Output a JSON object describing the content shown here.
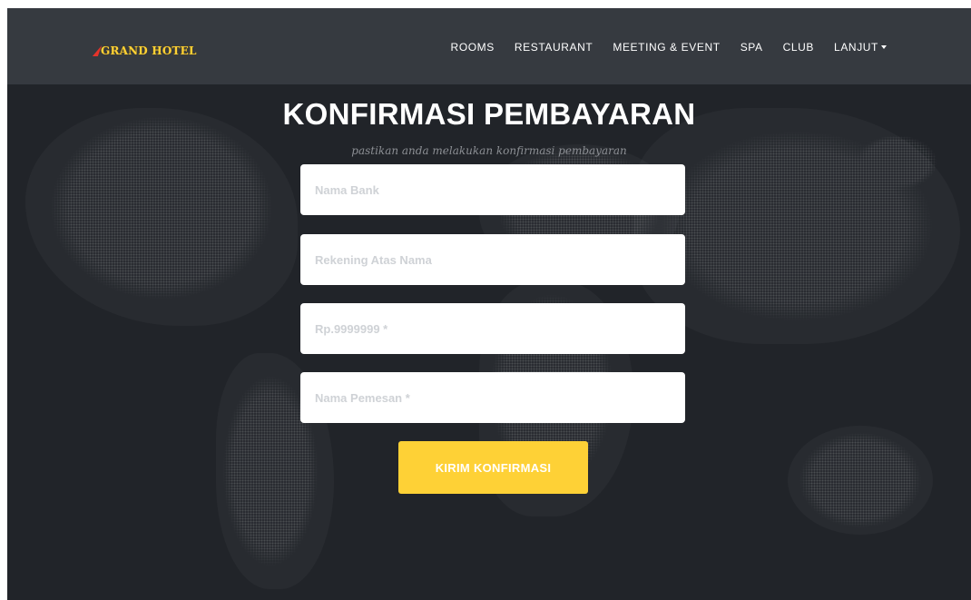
{
  "navbar": {
    "brand": "GRAND HOTEL",
    "items": [
      {
        "label": "ROOMS"
      },
      {
        "label": "RESTAURANT"
      },
      {
        "label": "MEETING & EVENT"
      },
      {
        "label": "SPA"
      },
      {
        "label": "CLUB"
      },
      {
        "label": "LANJUT"
      }
    ]
  },
  "page": {
    "title": "KONFIRMASI PEMBAYARAN",
    "subtitle": "pastikan anda melakukan konfirmasi pembayaran"
  },
  "form": {
    "bank_placeholder": "Nama Bank",
    "account_name_placeholder": "Rekening Atas Nama",
    "amount_placeholder": "Rp.9999999 *",
    "customer_name_placeholder": "Nama Pemesan *",
    "submit_label": "KIRIM KONFIRMASI"
  },
  "colors": {
    "accent": "#fed136",
    "navbar_bg": "#363a40",
    "page_bg": "#212429"
  }
}
